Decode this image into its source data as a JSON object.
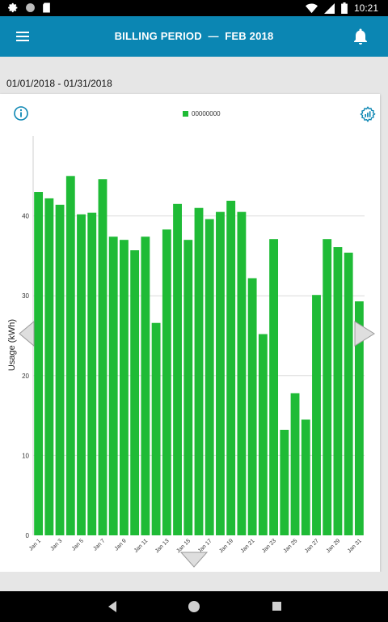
{
  "status_bar": {
    "time": "10:21",
    "icons": [
      "settings-icon",
      "record-icon",
      "sd-card-icon",
      "wifi-icon",
      "signal-icon",
      "battery-icon"
    ]
  },
  "app_bar": {
    "title": "BILLING PERIOD  —  FEB 2018",
    "menu_icon": "hamburger-menu-icon",
    "bell_icon": "bell-icon",
    "background": "#0b86b3"
  },
  "period": {
    "date_range": "01/01/2018 - 01/31/2018"
  },
  "chart_card": {
    "info_icon": "info-icon",
    "settings_icon": "gear-chart-icon",
    "nav_left_icon": "chevron-left-icon",
    "nav_right_icon": "chevron-right-icon",
    "nav_down_icon": "chevron-down-icon"
  },
  "chart_data": {
    "type": "bar",
    "ylabel": "Usage (kWh)",
    "ylim": [
      0,
      50
    ],
    "yticks": [
      0,
      10,
      20,
      30,
      40
    ],
    "grid": true,
    "bar_color": "#1fbb36",
    "legend": {
      "position": "top-center",
      "entries": [
        "00000000"
      ]
    },
    "categories": [
      "Jan 1",
      "Jan 2",
      "Jan 3",
      "Jan 4",
      "Jan 5",
      "Jan 6",
      "Jan 7",
      "Jan 8",
      "Jan 9",
      "Jan 10",
      "Jan 11",
      "Jan 12",
      "Jan 13",
      "Jan 14",
      "Jan 15",
      "Jan 16",
      "Jan 17",
      "Jan 18",
      "Jan 19",
      "Jan 20",
      "Jan 21",
      "Jan 22",
      "Jan 23",
      "Jan 24",
      "Jan 25",
      "Jan 26",
      "Jan 27",
      "Jan 28",
      "Jan 29",
      "Jan 30",
      "Jan 31"
    ],
    "tick_labels": [
      "Jan 1",
      "Jan 3",
      "Jan 5",
      "Jan 7",
      "Jan 9",
      "Jan 11",
      "Jan 13",
      "Jan 15",
      "Jan 17",
      "Jan 19",
      "Jan 21",
      "Jan 23",
      "Jan 25",
      "Jan 27",
      "Jan 29",
      "Jan 31"
    ],
    "series": [
      {
        "name": "00000000",
        "values": [
          43.0,
          42.2,
          41.4,
          45.0,
          40.2,
          40.4,
          44.6,
          37.4,
          37.0,
          35.7,
          37.4,
          26.6,
          38.3,
          41.5,
          37.0,
          41.0,
          39.6,
          40.5,
          41.9,
          40.5,
          32.2,
          25.2,
          37.1,
          13.2,
          17.8,
          14.5,
          30.1,
          37.1,
          36.1,
          35.4,
          29.3
        ]
      }
    ]
  },
  "system_nav": {
    "back_icon": "back-triangle-icon",
    "home_icon": "home-circle-icon",
    "recents_icon": "recents-square-icon"
  }
}
